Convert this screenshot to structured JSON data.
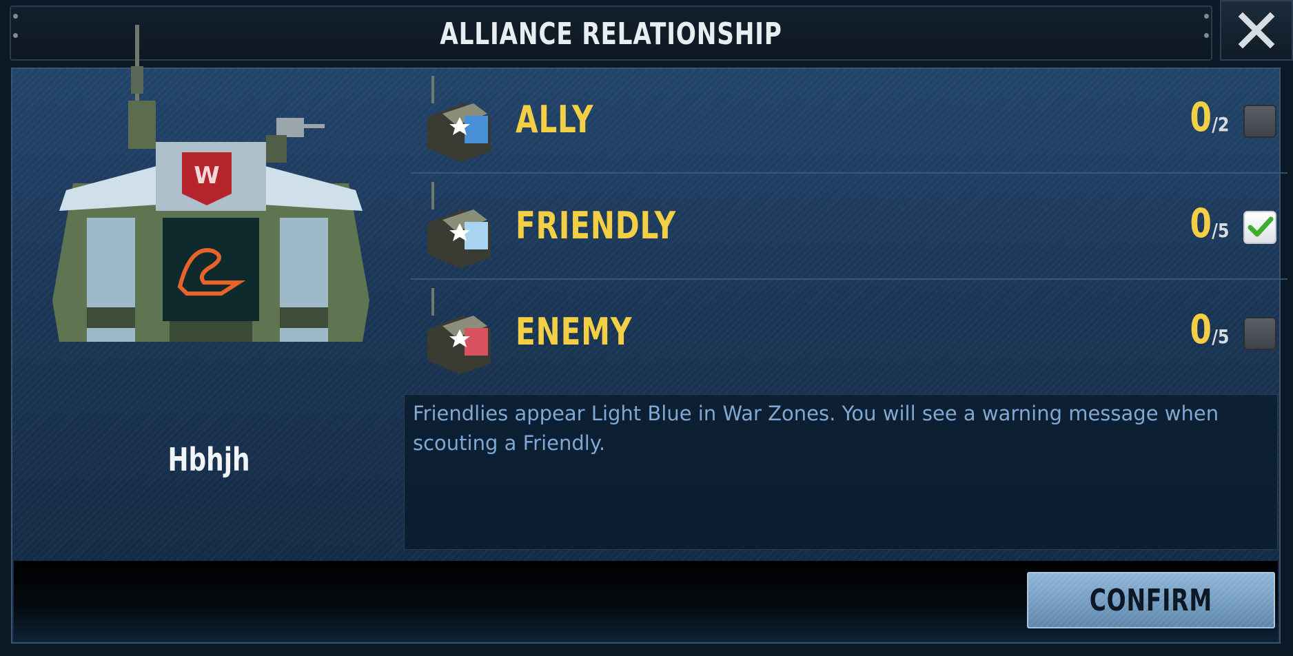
{
  "dialog": {
    "title": "ALLIANCE RELATIONSHIP",
    "close_icon": "close-x-icon"
  },
  "alliance": {
    "name": "Hbhjh",
    "emblem_icon": "alliance-hq-building-icon"
  },
  "relationships": [
    {
      "label": "ALLY",
      "count": "0",
      "max": "/2",
      "checked": false,
      "icon": "ally-base-icon",
      "accent": "#4a90d9"
    },
    {
      "label": "FRIENDLY",
      "count": "0",
      "max": "/5",
      "checked": true,
      "icon": "friendly-base-icon",
      "accent": "#a8d4f2"
    },
    {
      "label": "ENEMY",
      "count": "0",
      "max": "/5",
      "checked": false,
      "icon": "enemy-base-icon",
      "accent": "#d9535f"
    }
  ],
  "description": "Friendlies appear Light Blue in War Zones. You will see a warning message when scouting a Friendly.",
  "footer": {
    "confirm_label": "CONFIRM"
  },
  "colors": {
    "label_yellow": "#f3cf45",
    "desc_blue": "#7fa9d4",
    "check_green": "#3fae2f"
  }
}
